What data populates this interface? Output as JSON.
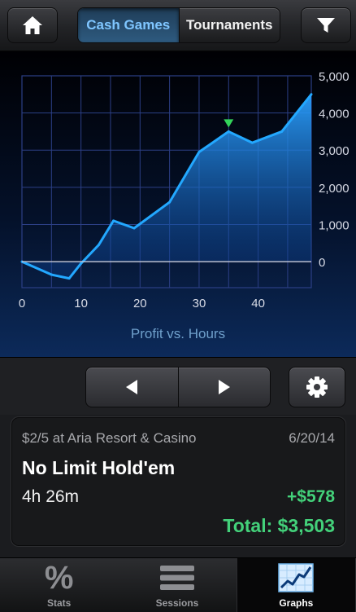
{
  "header": {
    "home_icon": "home-icon",
    "segments": [
      {
        "label": "Cash Games",
        "active": true
      },
      {
        "label": "Tournaments",
        "active": false
      }
    ],
    "filter_icon": "filter-icon"
  },
  "chart_data": {
    "type": "area",
    "title": "",
    "xlabel": "Profit vs. Hours",
    "ylabel": "",
    "x": [
      0,
      5,
      8,
      10,
      13,
      15.5,
      19,
      25,
      30,
      35,
      39,
      44,
      49
    ],
    "y": [
      0,
      -350,
      -450,
      -50,
      450,
      1100,
      900,
      1600,
      2950,
      3500,
      3200,
      3500,
      4500
    ],
    "xlim": [
      0,
      49
    ],
    "ylim": [
      -700,
      5000
    ],
    "xticks": [
      0,
      10,
      20,
      30,
      40
    ],
    "xtick_labels": [
      "0",
      "10",
      "20",
      "30",
      "40"
    ],
    "yticks": [
      0,
      1000,
      2000,
      3000,
      4000,
      5000
    ],
    "ytick_labels": [
      "0",
      "1,000",
      "2,000",
      "3,000",
      "4,000",
      "5,000"
    ],
    "marker_x": 35,
    "marker_y": 3500,
    "grid": true,
    "line_color": "#23a8ff",
    "marker_color": "#33d45a"
  },
  "controls": {
    "prev_icon": "triangle-left-icon",
    "next_icon": "triangle-right-icon",
    "settings_icon": "gear-icon"
  },
  "session": {
    "venue": "$2/5 at Aria Resort & Casino",
    "date": "6/20/14",
    "game": "No Limit Hold'em",
    "duration": "4h 26m",
    "profit": "+$578",
    "total": "Total: $3,503",
    "profit_color": "#43d17a"
  },
  "tabs": [
    {
      "label": "Stats",
      "icon": "percent-icon",
      "glyph": "%",
      "active": false
    },
    {
      "label": "Sessions",
      "icon": "list-icon",
      "active": false
    },
    {
      "label": "Graphs",
      "icon": "graph-icon",
      "active": true
    }
  ]
}
